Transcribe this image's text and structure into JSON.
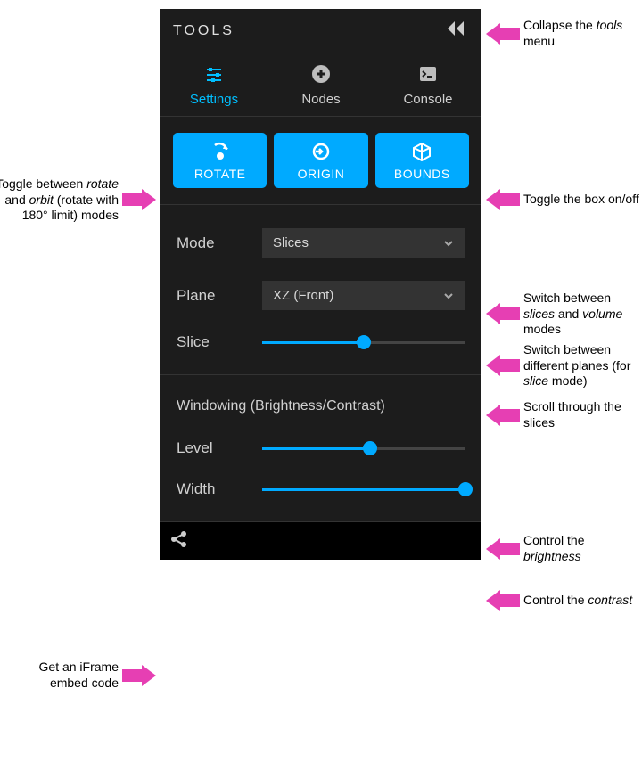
{
  "header": {
    "title": "TOOLS"
  },
  "tabs": [
    {
      "label": "Settings",
      "icon": "sliders-icon",
      "active": true
    },
    {
      "label": "Nodes",
      "icon": "plus-circle-icon",
      "active": false
    },
    {
      "label": "Console",
      "icon": "terminal-icon",
      "active": false
    }
  ],
  "mode_buttons": [
    {
      "label": "ROTATE",
      "icon": "rotate-icon"
    },
    {
      "label": "ORIGIN",
      "icon": "origin-icon"
    },
    {
      "label": "BOUNDS",
      "icon": "bounds-icon"
    }
  ],
  "view": {
    "mode_label": "Mode",
    "mode_value": "Slices",
    "plane_label": "Plane",
    "plane_value": "XZ (Front)",
    "slice_label": "Slice",
    "slice_percent": 50
  },
  "windowing": {
    "title": "Windowing (Brightness/Contrast)",
    "level_label": "Level",
    "level_percent": 53,
    "width_label": "Width",
    "width_percent": 100
  },
  "colors": {
    "accent": "#00aaff",
    "annotation": "#e63fb3"
  },
  "annotations": {
    "collapse": "Collapse the <em>tools</em> menu",
    "rotate": "Toggle between <em>rotate</em> and <em>orbit</em> (rotate with 180° limit) modes",
    "bounds": "Toggle the box on/off",
    "mode": "Switch between <em>slices</em> and <em>volume</em> modes",
    "plane": "Switch between different planes (for <em>slice</em> mode)",
    "slice": "Scroll through the slices",
    "level": "Control the <em>brightness</em>",
    "width": "Control the <em>contrast</em>",
    "share": "Get an iFrame embed code"
  }
}
